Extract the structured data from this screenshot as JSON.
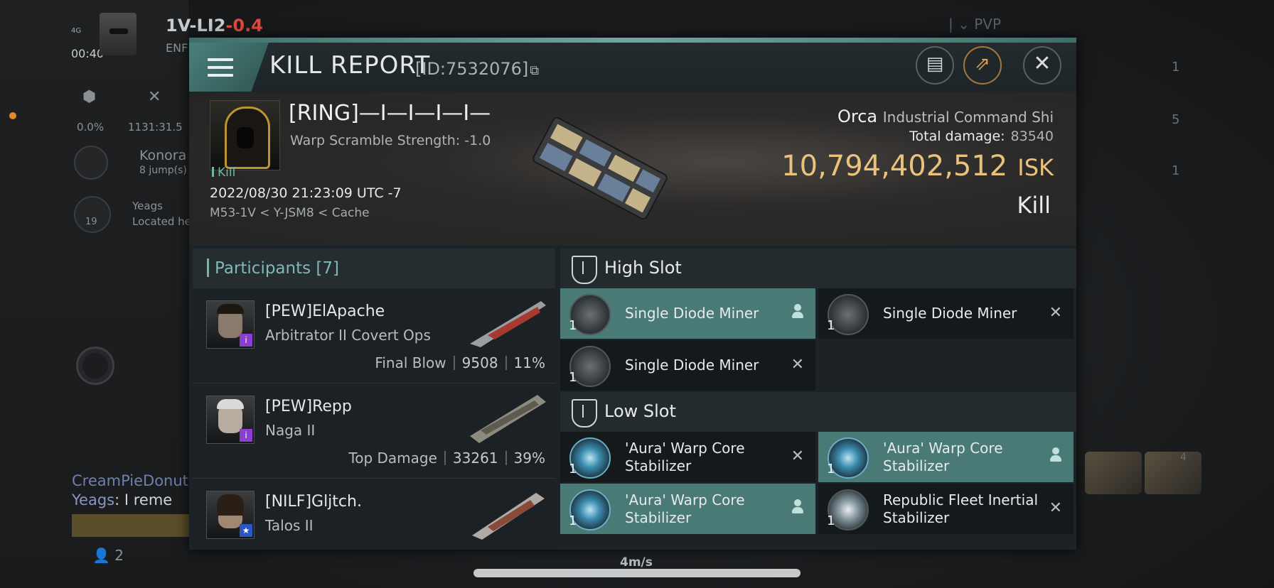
{
  "hud": {
    "system_name": "1V-LI2",
    "system_security": "-0.4",
    "signal": "4G",
    "clock": "00:40",
    "corp_short": "ENF",
    "stat_percent": "0.0%",
    "stat_distance": "1131:31.5",
    "target_name": "Konora",
    "target_jumps": "8 jump(s)",
    "fleet_count": "19",
    "fleet_name": "Yeags",
    "fleet_status": "Located he",
    "filter_label": "PVP",
    "chat_line1_name": "CreamPieDonut",
    "chat_line2_name": "Yeags",
    "chat_line2_text": ": I reme",
    "online_count": "2",
    "speed": "4m/s",
    "right_counts": [
      "1",
      "5",
      "1"
    ],
    "hangar_count": "4"
  },
  "window": {
    "title": "KILL REPORT",
    "report_id": "[ID:7532076]",
    "copy_icon": "copy-icon",
    "buttons": [
      "clipboard-icon",
      "share-icon",
      "close-icon"
    ]
  },
  "victim": {
    "name": "[RING]—I—I—I—I—",
    "warp_scramble": "Warp Scramble Strength: -1.0",
    "kill_tag": "Kill",
    "datetime": "2022/08/30 21:23:09 UTC -7",
    "location": "M53-1V < Y-JSM8 < Cache",
    "ship": "Orca",
    "ship_class": "Industrial Command Shi",
    "total_damage_label": "Total damage:",
    "total_damage": "83540",
    "isk_value": "10,794,402,512",
    "isk_unit": "ISK",
    "result": "Kill"
  },
  "participants": {
    "header": "Participants",
    "count": "[7]",
    "items": [
      {
        "name": "[PEW]ElApache",
        "ship": "Arbitrator II Covert Ops",
        "stat_label": "Final Blow",
        "damage": "9508",
        "percent": "11%",
        "badge": "i"
      },
      {
        "name": "[PEW]Repp",
        "ship": "Naga II",
        "stat_label": "Top Damage",
        "damage": "33261",
        "percent": "39%",
        "badge": "i"
      },
      {
        "name": "[NILF]Gljtch.",
        "ship": "Talos II",
        "badge": "★"
      }
    ]
  },
  "fitting": {
    "high_slot_label": "High Slot",
    "low_slot_label": "Low Slot",
    "high": [
      {
        "name": "Single Diode Miner",
        "qty": "1",
        "state": "dropped",
        "icon": "miner"
      },
      {
        "name": "Single Diode Miner",
        "qty": "1",
        "state": "destroyed",
        "icon": "miner"
      },
      {
        "name": "Single Diode Miner",
        "qty": "1",
        "state": "destroyed",
        "icon": "miner"
      }
    ],
    "low": [
      {
        "name": "'Aura' Warp Core Stabilizer",
        "qty": "1",
        "state": "destroyed",
        "icon": "stabilizer"
      },
      {
        "name": "'Aura' Warp Core Stabilizer",
        "qty": "1",
        "state": "dropped",
        "icon": "stabilizer"
      },
      {
        "name": "'Aura' Warp Core Stabilizer",
        "qty": "1",
        "state": "dropped",
        "icon": "stabilizer"
      },
      {
        "name": "Republic Fleet Inertial Stabilizer",
        "qty": "1",
        "state": "destroyed",
        "icon": "inertial"
      }
    ]
  },
  "colors": {
    "accent": "#4a7a75",
    "isk": "#e9c37c",
    "security": "#e04a3c"
  }
}
